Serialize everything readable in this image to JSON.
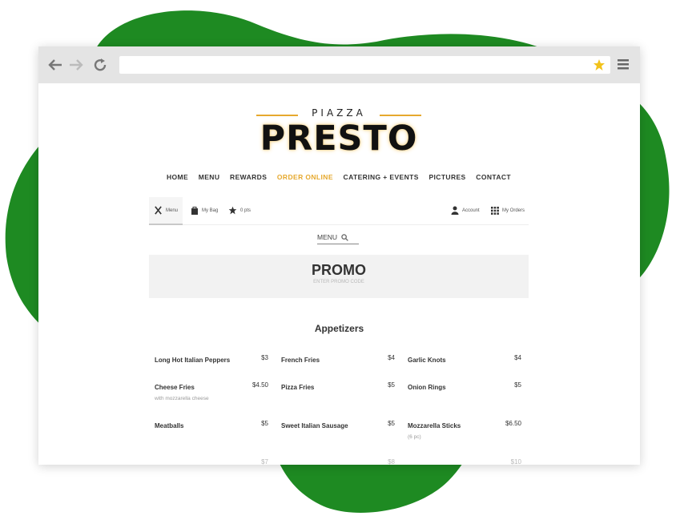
{
  "browser": {
    "url": "",
    "icons": [
      "back-arrow-icon",
      "forward-arrow-icon",
      "reload-icon",
      "bookmark-star-icon",
      "menu-hamburger-icon"
    ]
  },
  "site": {
    "logo_small": "PIAZZA",
    "logo_big": "PRESTO",
    "accent_color": "#e6a92e",
    "nav": [
      "HOME",
      "MENU",
      "REWARDS",
      "ORDER ONLINE",
      "CATERING + EVENTS",
      "PICTURES",
      "CONTACT"
    ],
    "nav_active": "ORDER ONLINE"
  },
  "order_bar": {
    "menu_tab": "Menu",
    "bag_tab": "My Bag",
    "points_tab": "0 pts",
    "account": "Account",
    "orders": "My Orders"
  },
  "menu_search": {
    "label": "MENU"
  },
  "promo": {
    "title": "PROMO",
    "subtitle": "ENTER PROMO CODE"
  },
  "section_title": "Appetizers",
  "items": [
    {
      "name": "Long Hot Italian Peppers",
      "price": "$3",
      "desc": ""
    },
    {
      "name": "French Fries",
      "price": "$4",
      "desc": ""
    },
    {
      "name": "Garlic Knots",
      "price": "$4",
      "desc": ""
    },
    {
      "name": "Cheese Fries",
      "price": "$4.50",
      "desc": "with mozzarella cheese"
    },
    {
      "name": "Pizza Fries",
      "price": "$5",
      "desc": ""
    },
    {
      "name": "Onion Rings",
      "price": "$5",
      "desc": ""
    },
    {
      "name": "Meatballs",
      "price": "$5",
      "desc": ""
    },
    {
      "name": "Sweet Italian Sausage",
      "price": "$5",
      "desc": ""
    },
    {
      "name": "Mozzarella Sticks",
      "price": "$6.50",
      "desc": "(6 pc)"
    },
    {
      "name": "",
      "price": "$7",
      "desc": ""
    },
    {
      "name": "",
      "price": "$8",
      "desc": ""
    },
    {
      "name": "",
      "price": "$10",
      "desc": ""
    }
  ],
  "colors": {
    "blob_green": "#1e8a22",
    "page_bg": "#ffffff",
    "chrome_bg": "#e4e4e4"
  }
}
